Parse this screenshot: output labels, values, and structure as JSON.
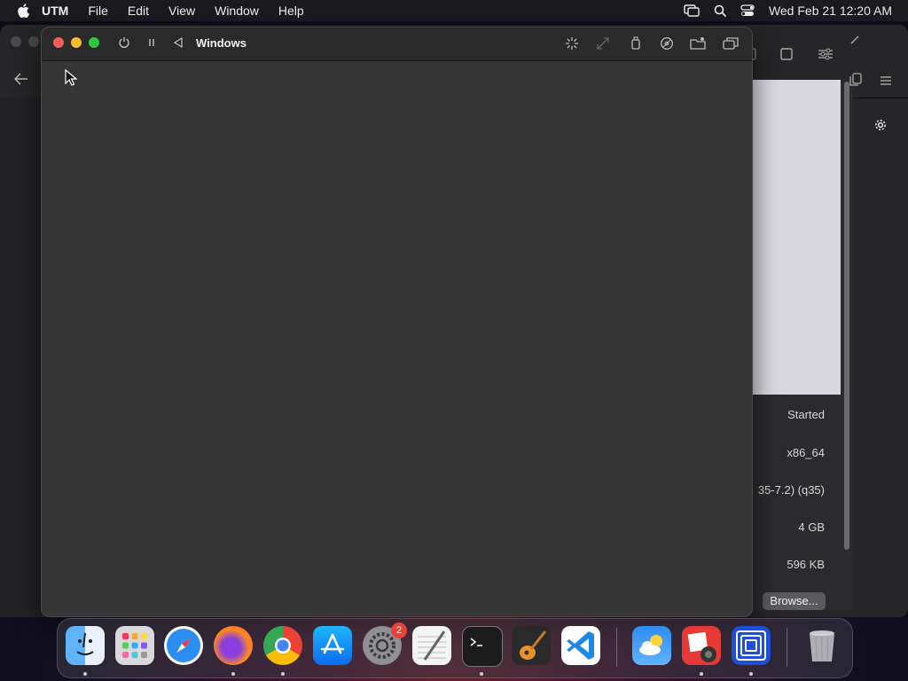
{
  "menubar": {
    "app_name": "UTM",
    "items": [
      "File",
      "Edit",
      "View",
      "Window",
      "Help"
    ],
    "datetime": "Wed Feb 21  12:20 AM"
  },
  "vm_window": {
    "title": "Windows"
  },
  "vm_info": {
    "status": "Started",
    "architecture": "x86_64",
    "machine": "35-7.2) (q35)",
    "memory": "4 GB",
    "size": "596 KB",
    "browse_label": "Browse..."
  },
  "dock": {
    "apps": [
      "finder-icon",
      "launchpad-icon",
      "safari-icon",
      "firefox-icon",
      "chrome-icon",
      "app-store-icon",
      "system-settings-icon",
      "textedit-icon",
      "terminal-icon",
      "garageband-icon",
      "vscode-icon",
      "weather-icon",
      "photo-booth-icon",
      "utm-icon",
      "trash-icon"
    ],
    "settings_badge": "2"
  },
  "colors": {
    "close": "#ee5f57",
    "minimize": "#f5bd2f",
    "maximize": "#2fc840",
    "vm_background": "#353535"
  }
}
